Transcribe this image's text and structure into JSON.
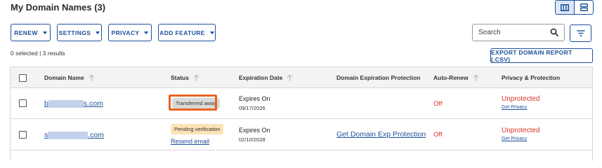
{
  "page": {
    "title": "My Domain Names (3)"
  },
  "view_toggle": {
    "active": "grid-view",
    "options": [
      "grid-view",
      "list-view"
    ]
  },
  "toolbar": {
    "renew_label": "RENEW",
    "settings_label": "SETTINGS",
    "privacy_label": "PRIVACY",
    "add_feature_label": "ADD FEATURE",
    "search_placeholder": "Search",
    "export_label": "EXPORT DOMAIN REPORT (.CSV)"
  },
  "selection": {
    "info": "0 selected | 3 results"
  },
  "table": {
    "headers": {
      "domain": "Domain Name",
      "status": "Status",
      "expiration": "Expiration Date",
      "protection": "Domain Expiration Protection",
      "autorenew": "Auto-Renew",
      "privacy": "Privacy & Protection"
    },
    "rows": [
      {
        "domain_prefix": "b",
        "domain_suffix": "s.com",
        "status": "Transferred away",
        "status_link": "",
        "expires_label": "Expires On",
        "expires_date": "09/17/2026",
        "protection_link": "",
        "autorenew": "Off",
        "privacy": "Unprotected",
        "privacy_link": "Get Privacy"
      },
      {
        "domain_prefix": "s",
        "domain_suffix": ".com",
        "status": "Pending verification",
        "status_link": "Resend email",
        "expires_label": "Expires On",
        "expires_date": "02/10/2028",
        "protection_link": "Get Domain Exp Protection",
        "autorenew": "Off",
        "privacy": "Unprotected",
        "privacy_link": "Get Privacy"
      }
    ]
  },
  "colors": {
    "brand": "#1f4f9c",
    "danger": "#d9342b",
    "highlight": "#e8641f",
    "badge_gray": "#d9d9d9",
    "badge_peach": "#fbe2b8"
  }
}
